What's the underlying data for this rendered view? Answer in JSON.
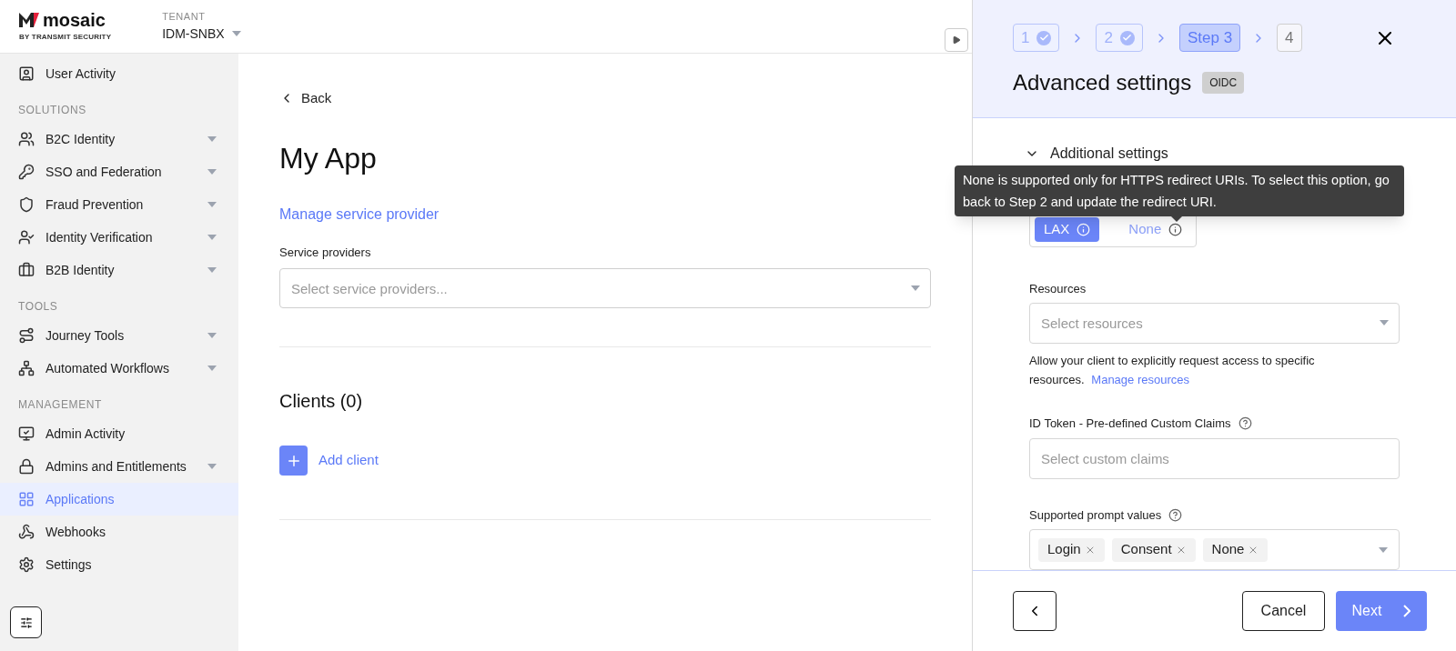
{
  "brand": {
    "name": "mosaic",
    "tagline": "BY TRANSMIT SECURITY"
  },
  "tenant": {
    "label": "TENANT",
    "value": "IDM-SNBX"
  },
  "sidebar": {
    "groups": [
      {
        "items": [
          {
            "label": "User Activity",
            "expandable": false,
            "selected": false
          }
        ]
      },
      {
        "heading": "SOLUTIONS",
        "items": [
          {
            "label": "B2C Identity",
            "expandable": true,
            "selected": false
          },
          {
            "label": "SSO and Federation",
            "expandable": true,
            "selected": false
          },
          {
            "label": "Fraud Prevention",
            "expandable": true,
            "selected": false
          },
          {
            "label": "Identity Verification",
            "expandable": true,
            "selected": false
          },
          {
            "label": "B2B Identity",
            "expandable": true,
            "selected": false
          }
        ]
      },
      {
        "heading": "TOOLS",
        "items": [
          {
            "label": "Journey Tools",
            "expandable": true,
            "selected": false
          },
          {
            "label": "Automated Workflows",
            "expandable": true,
            "selected": false
          }
        ]
      },
      {
        "heading": "MANAGEMENT",
        "items": [
          {
            "label": "Admin Activity",
            "expandable": false,
            "selected": false
          },
          {
            "label": "Admins and Entitlements",
            "expandable": true,
            "selected": false
          },
          {
            "label": "Applications",
            "expandable": false,
            "selected": true
          },
          {
            "label": "Webhooks",
            "expandable": false,
            "selected": false
          },
          {
            "label": "Settings",
            "expandable": false,
            "selected": false
          }
        ]
      }
    ]
  },
  "main": {
    "back": "Back",
    "title": "My App",
    "manage_link": "Manage service provider",
    "service_providers": {
      "label": "Service providers",
      "placeholder": "Select service providers..."
    },
    "clients_heading": "Clients (0)",
    "add_client": "Add client"
  },
  "panel": {
    "steps": [
      {
        "label": "1",
        "completed": true,
        "selected": false
      },
      {
        "label": "2",
        "completed": true,
        "selected": false
      },
      {
        "label": "Step 3",
        "completed": false,
        "selected": true
      },
      {
        "label": "4",
        "completed": false,
        "selected": false
      }
    ],
    "title": "Advanced settings",
    "badge": "OIDC",
    "section": {
      "label": "Additional settings",
      "expanded": true
    },
    "same_site": [
      {
        "label": "LAX",
        "selected": true,
        "disabled": false
      },
      {
        "label": "None",
        "selected": false,
        "disabled": true
      }
    ],
    "tooltip": "None is supported only for HTTPS redirect URIs. To select this option, go back to Step 2 and update the redirect URI.",
    "resources": {
      "label": "Resources",
      "placeholder": "Select resources",
      "help": "Allow your client to explicitly request access to specific resources.",
      "link": "Manage resources"
    },
    "id_token": {
      "label": "ID Token - Pre-defined Custom Claims",
      "placeholder": "Select custom claims"
    },
    "prompt": {
      "label": "Supported prompt values",
      "tags": [
        "Login",
        "Consent",
        "None"
      ]
    },
    "footer": {
      "cancel": "Cancel",
      "next": "Next"
    }
  }
}
